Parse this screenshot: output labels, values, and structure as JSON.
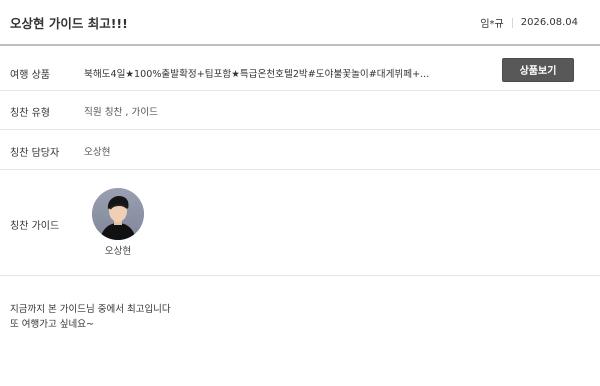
{
  "header": {
    "title": "오상현 가이드 최고!!!",
    "author": "임*규",
    "date": "2026.08.04"
  },
  "fields": {
    "product": {
      "label": "여행 상품",
      "value": "북해도4일★100%출발확정+팁포함★특급온천호텔2박#도야불꽃놀이#대게뷔페+...",
      "button_label": "상품보기"
    },
    "praise_type": {
      "label": "칭찬 유형",
      "value": "직원 칭찬 , 가이드"
    },
    "praise_person": {
      "label": "칭찬 담당자",
      "value": "오상현"
    },
    "praise_guide": {
      "label": "칭찬 가이드",
      "guide_name": "오상현"
    }
  },
  "comment": {
    "line1": "지금까지 본 가이드님 중에서 최고입니다",
    "line2": "또 여행가고 싶네요~"
  },
  "colors": {
    "button_bg": "#585858",
    "divider": "#bdbdbd",
    "row_border": "#e6e6e6",
    "avatar_bg": "#8f95a5"
  }
}
